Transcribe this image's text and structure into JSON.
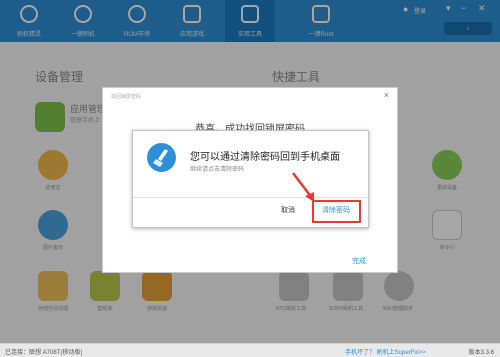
{
  "top_nav": {
    "items": [
      {
        "label": "刷机精灵"
      },
      {
        "label": "一键刷机"
      },
      {
        "label": "ROM市场"
      },
      {
        "label": "应用游戏"
      },
      {
        "label": "实用工具"
      },
      {
        "label": "一键Root"
      }
    ],
    "login_label": "登录",
    "one_key_label": "一键Root"
  },
  "sections": {
    "device_manage": "设备管理",
    "quick_tools": "快捷工具",
    "app_manage": "应用管理",
    "app_manage_sub": "管理手机上",
    "tiles_left": [
      "应用宝",
      "图片备份",
      "存储空间清理",
      "壁纸库",
      "游戏加速"
    ],
    "tiles_right": [
      "重启设备",
      "命令行",
      "HTC刷机工具",
      "SONY刷机工具",
      "WiFi管理助手"
    ]
  },
  "dialog_back": {
    "title": "找回锁屏密码",
    "headline": "恭喜，成功找回锁屏密码",
    "close": "×",
    "done_label": "完成"
  },
  "dialog_front": {
    "title": "您可以通过清除密码回到手机桌面",
    "subtitle": "继续请点击清除密码",
    "cancel_label": "取消",
    "clear_label": "清除密码"
  },
  "status_bar": {
    "left": "已连接：联想 A708T(移动版)",
    "mid": "手机坏了？ 刷机上SuperFix>>",
    "right": "版本3.3.6"
  }
}
